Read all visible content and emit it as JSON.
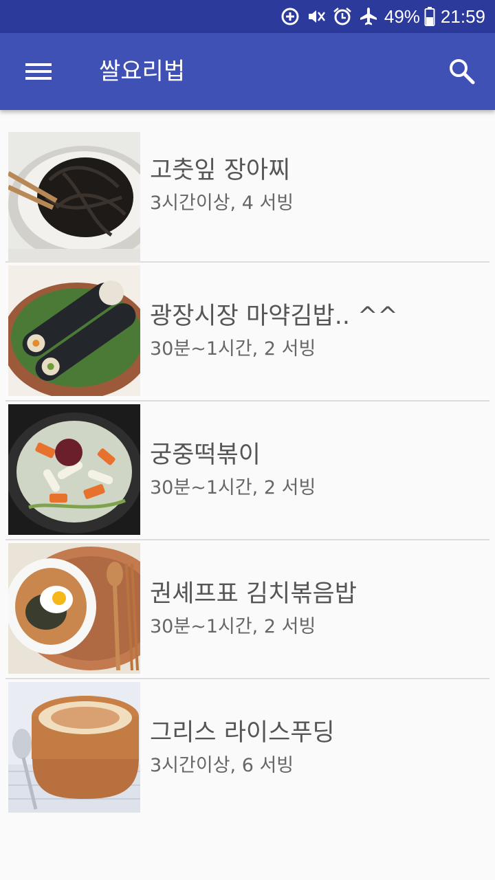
{
  "status_bar": {
    "battery_percent": "49%",
    "time": "21:59",
    "icons": [
      "data-saver-icon",
      "vibrate-mute-icon",
      "alarm-icon",
      "airplane-mode-icon",
      "battery-icon"
    ]
  },
  "app_bar": {
    "title": "쌀요리법",
    "menu_icon": "hamburger-menu-icon",
    "search_icon": "search-icon",
    "color": "#3F51B5",
    "status_color": "#2C3A9C"
  },
  "recipes": [
    {
      "title": "고춧잎 장아찌",
      "meta": "3시간이상, 4 서빙",
      "thumb": "pickled-pepper-leaves"
    },
    {
      "title": "광장시장 마약김밥.. ^^",
      "meta": "30분~1시간, 2 서빙",
      "thumb": "mayak-gimbap"
    },
    {
      "title": "궁중떡볶이",
      "meta": "30분~1시간, 2 서빙",
      "thumb": "royal-tteokbokki"
    },
    {
      "title": "권셰프표 김치볶음밥",
      "meta": "30분~1시간, 2 서빙",
      "thumb": "kimchi-fried-rice"
    },
    {
      "title": "그리스 라이스푸딩",
      "meta": "3시간이상, 6 서빙",
      "thumb": "greek-rice-pudding"
    }
  ]
}
